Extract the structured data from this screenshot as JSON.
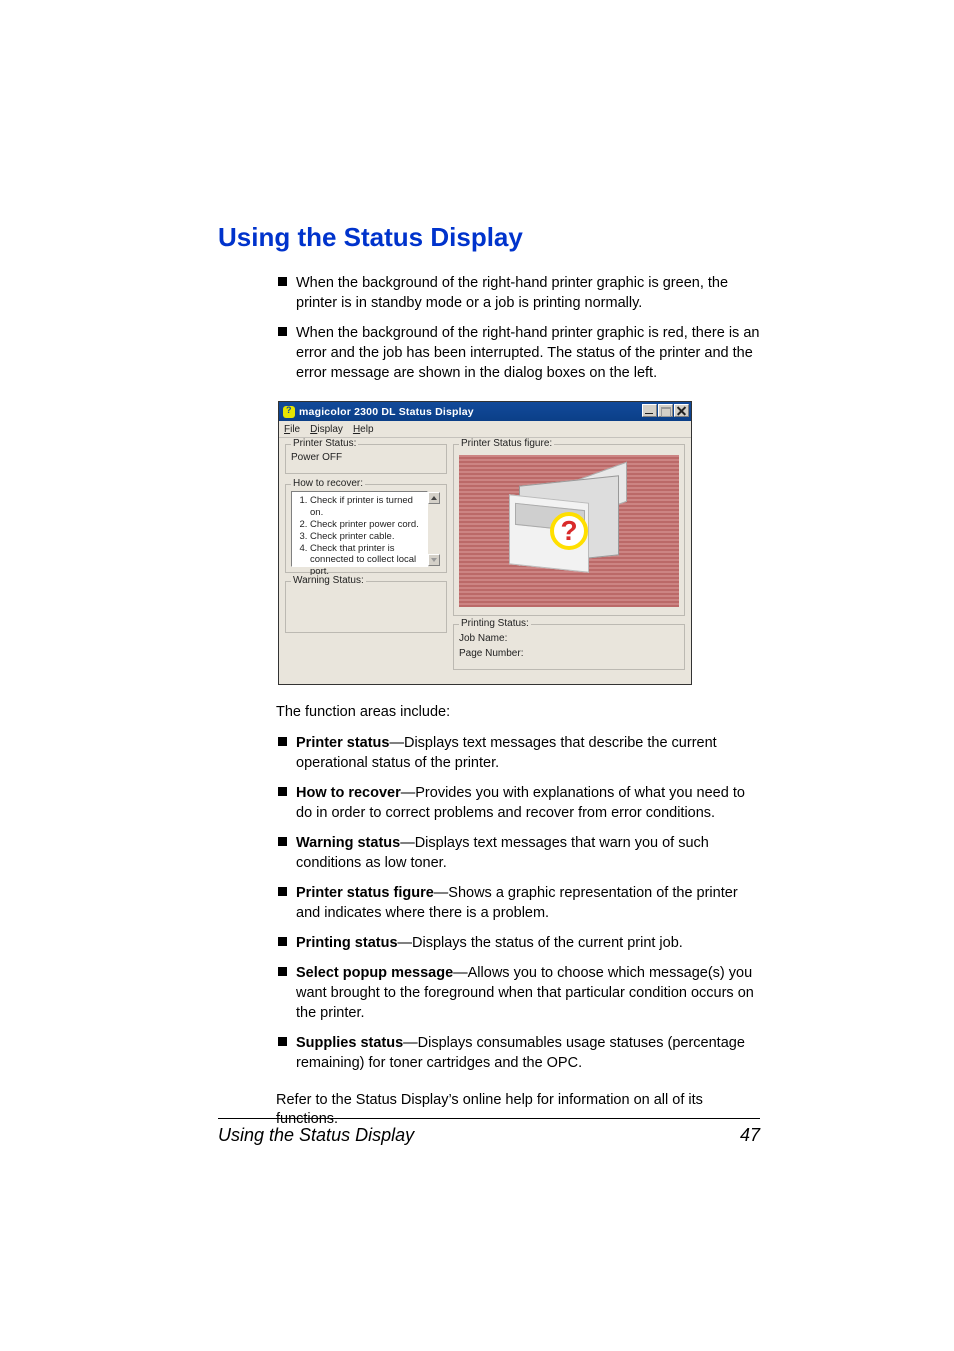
{
  "heading": "Using the Status Display",
  "topBullets": [
    "When the background of the right-hand printer graphic is green, the printer is in standby mode or a job is printing normally.",
    "When the background of the right-hand printer graphic is red, there is an error and the job has been interrupted. The status of the printer and the error message are shown in the dialog boxes on the left."
  ],
  "appWindow": {
    "title": "magicolor 2300 DL Status Display",
    "menu": {
      "file": "File",
      "display": "Display",
      "help": "Help"
    },
    "printerStatus": {
      "legend": "Printer Status:",
      "value": "Power OFF"
    },
    "howToRecover": {
      "legend": "How to recover:",
      "steps": [
        "Check if printer is turned on.",
        "Check printer power cord.",
        "Check printer cable.",
        "Check that printer is connected to collect local port."
      ]
    },
    "warningStatus": {
      "legend": "Warning Status:"
    },
    "printerStatusFigure": {
      "legend": "Printer Status figure:"
    },
    "printingStatus": {
      "legend": "Printing Status:",
      "jobNameLabel": "Job Name:",
      "pageNumberLabel": "Page Number:"
    }
  },
  "functionIntro": "The function areas include:",
  "functionAreas": [
    {
      "term": "Printer status",
      "desc": "—Displays text messages that describe the current operational status of the printer."
    },
    {
      "term": "How to recover",
      "desc": "—Provides you with explanations of what you need to do in order to correct problems and recover from error conditions."
    },
    {
      "term": "Warning status",
      "desc": "—Displays text messages that warn you of such conditions as low toner."
    },
    {
      "term": "Printer status figure",
      "desc": "—Shows a graphic representation of the printer and indicates where there is a problem."
    },
    {
      "term": "Printing status",
      "desc": "—Displays the status of the current print job."
    },
    {
      "term": "Select popup message",
      "desc": "—Allows you to choose which message(s) you want brought to the foreground when that particular condition occurs on the printer."
    },
    {
      "term": "Supplies status",
      "desc": "—Displays consumables usage statuses (percentage remaining) for toner cartridges and the OPC."
    }
  ],
  "closing": "Refer to the Status Display’s online help for information on all of its functions.",
  "footer": {
    "title": "Using the Status Display",
    "page": "47"
  }
}
